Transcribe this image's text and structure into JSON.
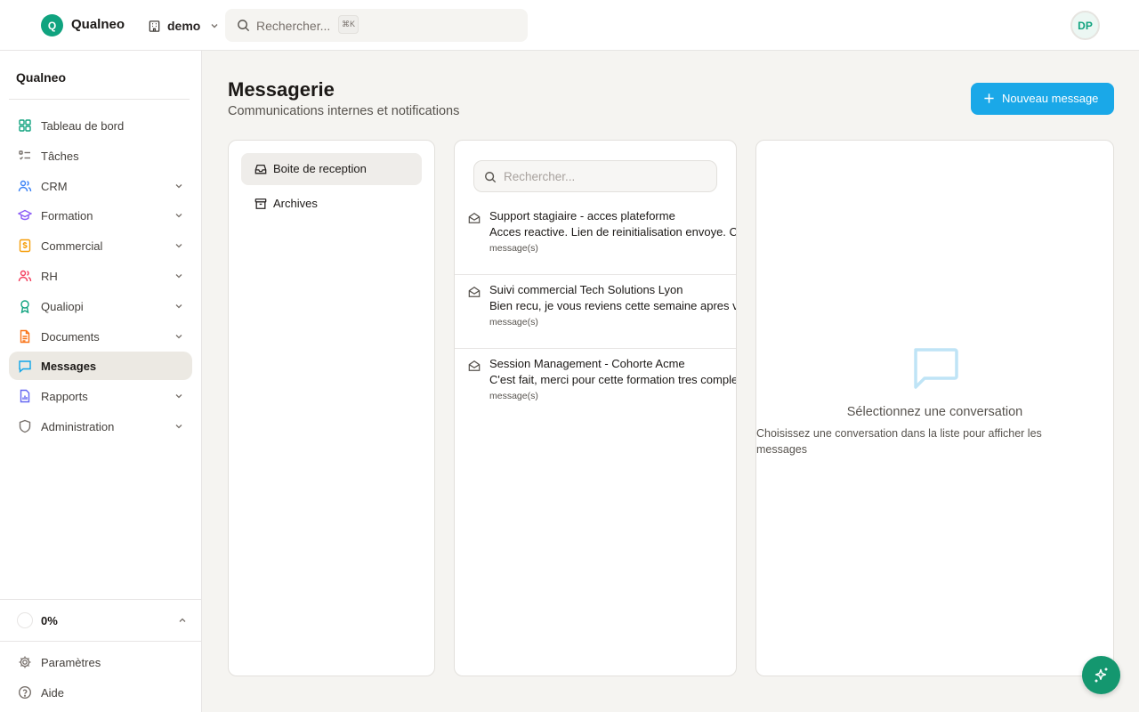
{
  "app": {
    "name": "Qualneo",
    "logo_letter": "Q"
  },
  "header": {
    "workspace": "demo",
    "search_placeholder": "Rechercher...",
    "search_shortcut": "⌘K",
    "user_initials": "DP"
  },
  "sidebar": {
    "title": "Qualneo",
    "items": [
      {
        "label": "Tableau de bord",
        "icon": "dashboard-icon",
        "color": "#10a37f"
      },
      {
        "label": "Tâches",
        "icon": "tasks-icon",
        "color": "#78716c"
      },
      {
        "label": "CRM",
        "icon": "users-icon",
        "color": "#3b82f6"
      },
      {
        "label": "Formation",
        "icon": "graduation-cap-icon",
        "color": "#8b5cf6"
      },
      {
        "label": "Commercial",
        "icon": "dollar-icon",
        "color": "#f59e0b"
      },
      {
        "label": "RH",
        "icon": "people-icon",
        "color": "#f43f5e"
      },
      {
        "label": "Qualiopi",
        "icon": "award-icon",
        "color": "#10a37f"
      },
      {
        "label": "Documents",
        "icon": "file-icon",
        "color": "#f97316"
      },
      {
        "label": "Messages",
        "icon": "message-icon",
        "color": "#0ea5e9"
      },
      {
        "label": "Rapports",
        "icon": "report-icon",
        "color": "#6366f1"
      },
      {
        "label": "Administration",
        "icon": "shield-icon",
        "color": "#78716c"
      }
    ],
    "progress": "0%",
    "settings": "Paramètres",
    "help": "Aide"
  },
  "main": {
    "title": "Messagerie",
    "subtitle": "Communications internes et notifications",
    "new_button": "Nouveau message",
    "folders": [
      {
        "label": "Boite de reception",
        "active": true
      },
      {
        "label": "Archives",
        "active": false
      }
    ],
    "list_search_placeholder": "Rechercher...",
    "conversations": [
      {
        "title": "Support stagiaire - acces plateforme",
        "preview": "Acces reactive. Lien de reinitialisation envoye. Cordialement",
        "meta": "message(s)"
      },
      {
        "title": "Suivi commercial Tech Solutions Lyon",
        "preview": "Bien recu, je vous reviens cette semaine apres validation interne",
        "meta": "message(s)"
      },
      {
        "title": "Session Management - Cohorte Acme",
        "preview": "C'est fait, merci pour cette formation tres complete",
        "meta": "message(s)"
      }
    ],
    "empty": {
      "title": "Sélectionnez une conversation",
      "description": "Choisissez une conversation dans la liste pour afficher les messages"
    }
  },
  "colors": {
    "accent": "#10a37f",
    "primary_button": "#1aa8e8",
    "empty_icon": "#bfe4f6"
  }
}
